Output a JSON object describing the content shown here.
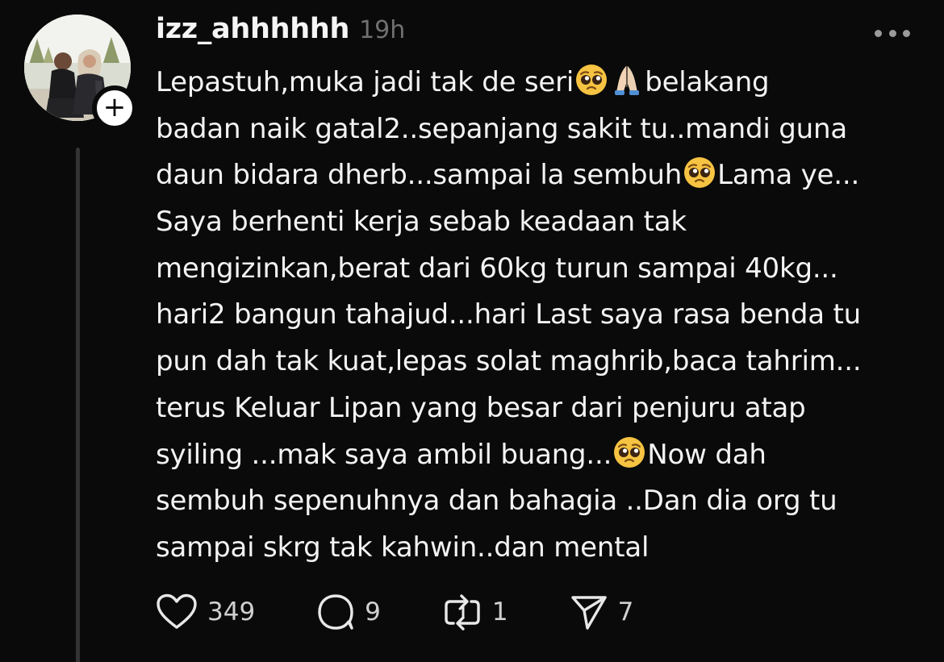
{
  "post": {
    "username": "izz_ahhhhhh",
    "timestamp": "19h",
    "follow_glyph": "+",
    "more_icon": "more-horizontal-icon",
    "lines": [
      [
        "Lepastuh,muka jadi tak de seri",
        "belakang"
      ],
      [
        "badan naik gatal2..sepanjang sakit tu..mandi guna"
      ],
      [
        "daun bidara dherb...sampai la sembuh",
        "Lama ye..."
      ],
      [
        "Saya berhenti kerja sebab keadaan tak"
      ],
      [
        "mengizinkan,berat dari 60kg turun sampai 40kg..."
      ],
      [
        "hari2 bangun tahajud...hari Last saya rasa benda tu"
      ],
      [
        "pun dah tak kuat,lepas solat maghrib,baca tahrim..."
      ],
      [
        "terus Keluar Lipan yang besar dari penjuru atap"
      ],
      [
        "syiling ...mak saya ambil buang...",
        "Now dah"
      ],
      [
        "sembuh sepenuhnya dan bahagia ..Dan dia org tu"
      ],
      [
        "sampai skrg tak kahwin..dan mental"
      ]
    ],
    "emojis": [
      "pleading-face",
      "folded-hands",
      "pleading-face",
      "pleading-face"
    ]
  },
  "actions": {
    "likes": "349",
    "replies": "9",
    "reposts": "1",
    "shares": "7"
  },
  "colors": {
    "background": "#0a0a0a",
    "text": "#f3f3f3",
    "muted": "#707070",
    "thread_line": "#333333"
  }
}
